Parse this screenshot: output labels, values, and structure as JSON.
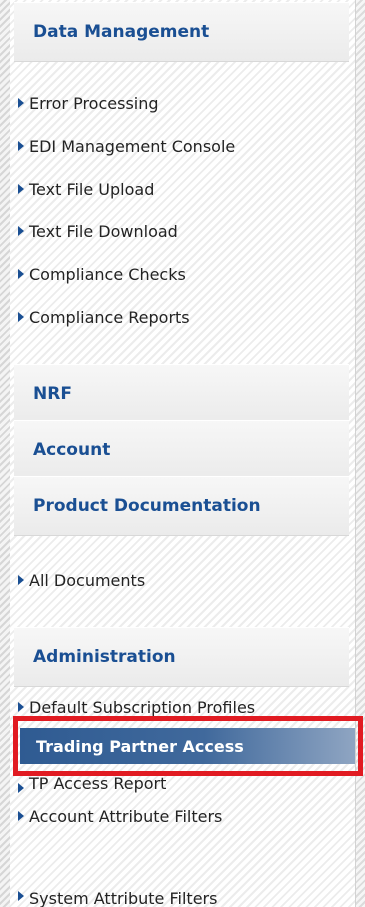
{
  "menu": {
    "sections": {
      "data_management": {
        "title": "Data Management",
        "items": [
          "Error Processing",
          "EDI Management Console",
          "Text File Upload",
          "Text File Download",
          "Compliance Checks",
          "Compliance Reports"
        ]
      },
      "nrf": {
        "title": "NRF"
      },
      "account": {
        "title": "Account"
      },
      "product_documentation": {
        "title": "Product Documentation",
        "items": [
          "All Documents"
        ]
      },
      "administration": {
        "title": "Administration",
        "items": [
          "Default Subscription Profiles",
          "Trading Partner Access",
          "TP Access Report",
          "Account Attribute Filters",
          "System Attribute Filters"
        ],
        "selected": "Trading Partner Access"
      }
    }
  },
  "colors": {
    "header_text": "#1a4f93",
    "selected_bg": "#2f5b92",
    "highlight_border": "#e11b22"
  }
}
